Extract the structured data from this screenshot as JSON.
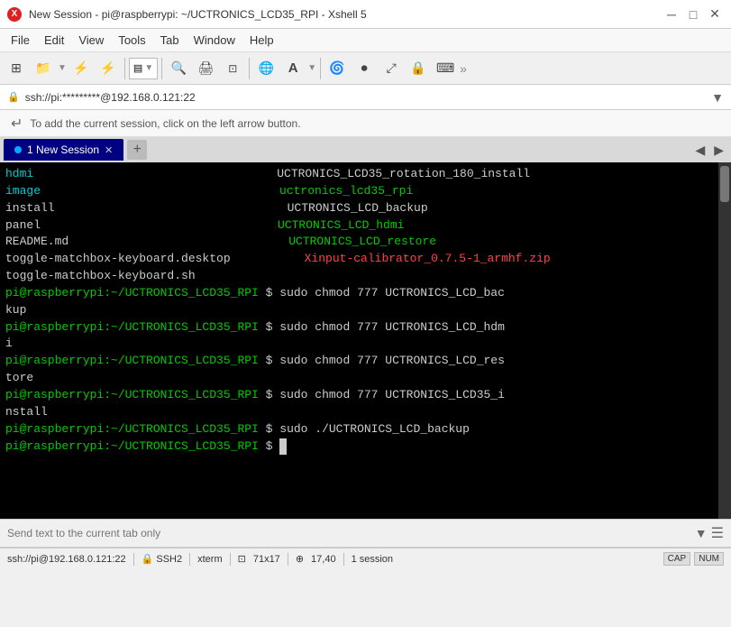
{
  "titlebar": {
    "title": "New Session - pi@raspberrypi: ~/UCTRONICS_LCD35_RPI - Xshell 5",
    "app_icon": "X"
  },
  "menubar": {
    "items": [
      "File",
      "Edit",
      "View",
      "Tools",
      "Tab",
      "Window",
      "Help"
    ]
  },
  "address": {
    "icon": "🔒",
    "text": "ssh://pi:*********@192.168.0.121:22"
  },
  "infobar": {
    "text": "To add the current session, click on the left arrow button."
  },
  "tab": {
    "label": "1 New Session"
  },
  "terminal": {
    "lines_left": [
      "hdmi",
      "image",
      "install",
      "panel",
      "README.md",
      "toggle-matchbox-keyboard.desktop",
      "toggle-matchbox-keyboard.sh",
      "pi@raspberrypi:~/UCTRONICS_LCD35_RPI $ sudo chmod 777 UCTRONICS_LCD_bac",
      "kup",
      "pi@raspberrypi:~/UCTRONICS_LCD35_RPI $ sudo chmod 777 UCTRONICS_LCD_hdm",
      "i",
      "pi@raspberrypi:~/UCTRONICS_LCD35_RPI $ sudo chmod 777 UCTRONICS_LCD_res",
      "tore",
      "pi@raspberrypi:~/UCTRONICS_LCD35_RPI $ sudo chmod 777 UCTRONICS_LCD35_i",
      "nstall",
      "pi@raspberrypi:~/UCTRONICS_LCD35_RPI $ sudo ./UCTRONICS_LCD_backup",
      "pi@raspberrypi:~/UCTRONICS_LCD35_RPI $ "
    ],
    "lines_right": [
      "UCTRONICS_LCD35_rotation_180_install",
      "uctronics_lcd35_rpi",
      "UCTRONICS_LCD_backup",
      "UCTRONICS_LCD_hdmi",
      "UCTRONICS_LCD_restore",
      "Xinput-calibrator_0.7.5-1_armhf.zip"
    ]
  },
  "sendbar": {
    "placeholder": "Send text to the current tab only"
  },
  "statusbar": {
    "connection": "ssh://pi@192.168.0.121:22",
    "protocol": "SSH2",
    "terminal": "xterm",
    "size": "71x17",
    "position": "17,40",
    "sessions": "1 session",
    "cap": "CAP",
    "num": "NUM"
  }
}
